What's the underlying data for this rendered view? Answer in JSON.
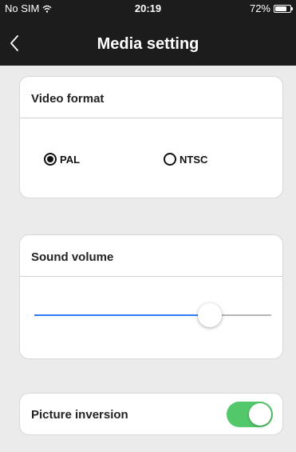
{
  "status_bar": {
    "carrier": "No SIM",
    "time": "20:19",
    "battery": "72%"
  },
  "nav": {
    "title": "Media setting"
  },
  "video_format": {
    "title": "Video format",
    "options": [
      {
        "label": "PAL",
        "selected": true
      },
      {
        "label": "NTSC",
        "selected": false
      }
    ]
  },
  "sound_volume": {
    "title": "Sound volume",
    "level_percent": 74
  },
  "picture_inversion": {
    "title": "Picture inversion",
    "enabled": true
  },
  "colors": {
    "accent": "#2f7cf6",
    "toggle_on": "#52c86a",
    "header_bg": "#1c1c1c"
  }
}
